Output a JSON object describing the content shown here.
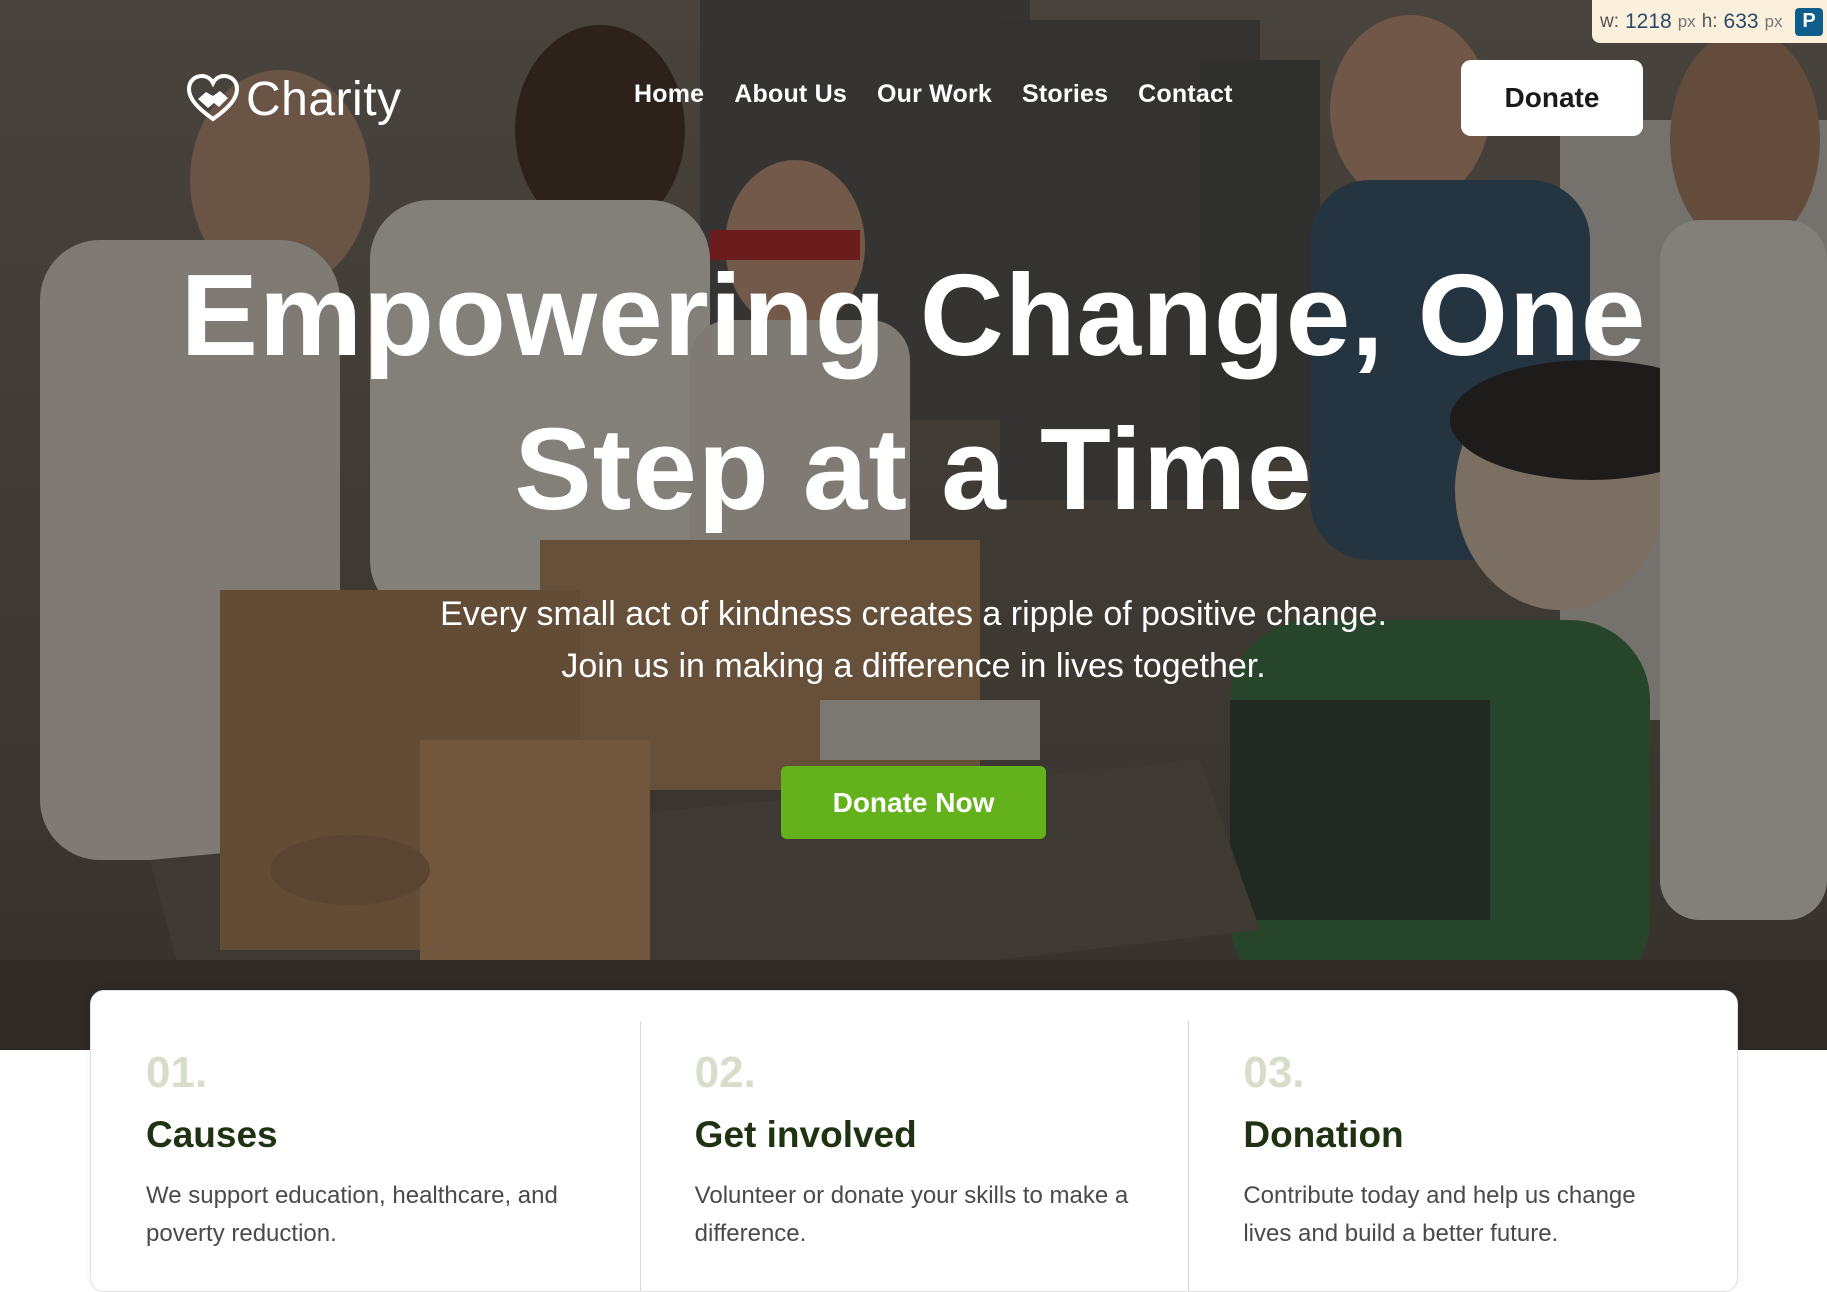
{
  "brand": {
    "name": "Charity"
  },
  "nav": {
    "items": [
      "Home",
      "About Us",
      "Our Work",
      "Stories",
      "Contact"
    ],
    "donate_label": "Donate"
  },
  "hero": {
    "headline": "Empowering Change, One Step at a Time",
    "subtext_line1": "Every small act of kindness creates a ripple of positive change.",
    "subtext_line2": "Join us in making a difference in lives together.",
    "cta_label": "Donate Now",
    "cta_color": "#63b21b"
  },
  "features": [
    {
      "number": "01.",
      "title": "Causes",
      "description": "We support education, healthcare, and poverty reduction."
    },
    {
      "number": "02.",
      "title": "Get involved",
      "description": "Volunteer or donate your skills to make a difference."
    },
    {
      "number": "03.",
      "title": "Donation",
      "description": "Contribute today and help us change lives and build a better future."
    }
  ],
  "ruler_overlay": {
    "w_label": "w:",
    "w_value": "1218",
    "h_label": "h:",
    "h_value": "633",
    "unit": "px",
    "icon_letter": "P"
  },
  "colors": {
    "accent_green": "#63b21b",
    "feature_number": "#d6dec9",
    "feature_title": "#1f3212"
  }
}
